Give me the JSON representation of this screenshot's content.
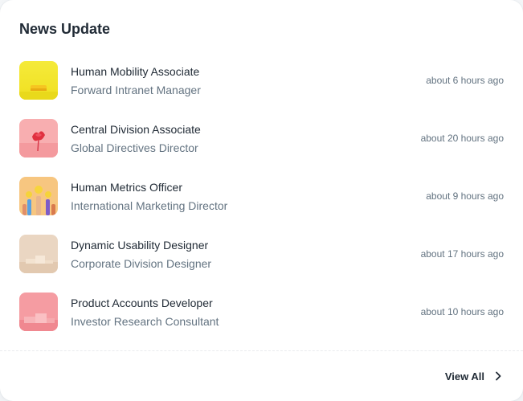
{
  "card": {
    "title": "News Update",
    "view_all_label": "View All"
  },
  "items": [
    {
      "title": "Human Mobility Associate",
      "subtitle": "Forward Intranet Manager",
      "time": "about 6 hours ago",
      "thumb_icon": "yellow-pedestal-thumbnail",
      "thumb_color": "#f2e52e"
    },
    {
      "title": "Central Division Associate",
      "subtitle": "Global Directives Director",
      "time": "about 20 hours ago",
      "thumb_icon": "red-flower-thumbnail",
      "thumb_color": "#f7a5a8"
    },
    {
      "title": "Human Metrics Officer",
      "subtitle": "International Marketing Director",
      "time": "about 9 hours ago",
      "thumb_icon": "raised-hands-thumbnail",
      "thumb_color": "#f6c27a"
    },
    {
      "title": "Dynamic Usability Designer",
      "subtitle": "Corporate Division Designer",
      "time": "about 17 hours ago",
      "thumb_icon": "beige-pedestals-thumbnail",
      "thumb_color": "#ecd9c5"
    },
    {
      "title": "Product Accounts Developer",
      "subtitle": "Investor Research Consultant",
      "time": "about 10 hours ago",
      "thumb_icon": "pink-pedestals-thumbnail",
      "thumb_color": "#f59aa0"
    }
  ],
  "colors": {
    "text_primary": "#212b36",
    "text_secondary": "#637381"
  }
}
